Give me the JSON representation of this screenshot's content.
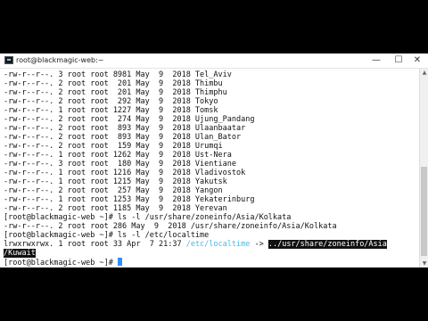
{
  "window": {
    "title": "root@blackmagic-web:~",
    "controls": {
      "minimize": "—",
      "maximize": "☐",
      "close": "✕"
    }
  },
  "icons": {
    "app": "terminal-icon"
  },
  "colors": {
    "symlink": "#49b9e6",
    "cursor": "#2f8fff",
    "selection": "#111111"
  },
  "terminal": {
    "lines": [
      "-rw-r--r--. 3 root root 8981 May  9  2018 Tel_Aviv",
      "-rw-r--r--. 2 root root  201 May  9  2018 Thimbu",
      "-rw-r--r--. 2 root root  201 May  9  2018 Thimphu",
      "-rw-r--r--. 2 root root  292 May  9  2018 Tokyo",
      "-rw-r--r--. 1 root root 1227 May  9  2018 Tomsk",
      "-rw-r--r--. 2 root root  274 May  9  2018 Ujung_Pandang",
      "-rw-r--r--. 2 root root  893 May  9  2018 Ulaanbaatar",
      "-rw-r--r--. 2 root root  893 May  9  2018 Ulan_Bator",
      "-rw-r--r--. 2 root root  159 May  9  2018 Urumqi",
      "-rw-r--r--. 1 root root 1262 May  9  2018 Ust-Nera",
      "-rw-r--r--. 3 root root  180 May  9  2018 Vientiane",
      "-rw-r--r--. 1 root root 1216 May  9  2018 Vladivostok",
      "-rw-r--r--. 1 root root 1215 May  9  2018 Yakutsk",
      "-rw-r--r--. 2 root root  257 May  9  2018 Yangon",
      "-rw-r--r--. 1 root root 1253 May  9  2018 Yekaterinburg",
      "-rw-r--r--. 2 root root 1185 May  9  2018 Yerevan",
      "[root@blackmagic-web ~]# ls -l /usr/share/zoneinfo/Asia/Kolkata",
      "-rw-r--r--. 2 root root 286 May  9  2018 /usr/share/zoneinfo/Asia/Kolkata",
      "[root@blackmagic-web ~]# ls -l /etc/localtime"
    ],
    "symlink": {
      "prefix": "lrwxrwxrwx. 1 root root 33 Apr  7 21:37 ",
      "name": "/etc/localtime",
      "arrow": " -> ",
      "target_line1": "../usr/share/zoneinfo/Asia",
      "target_line2": "/Kuwait"
    },
    "prompt": "[root@blackmagic-web ~]# "
  }
}
